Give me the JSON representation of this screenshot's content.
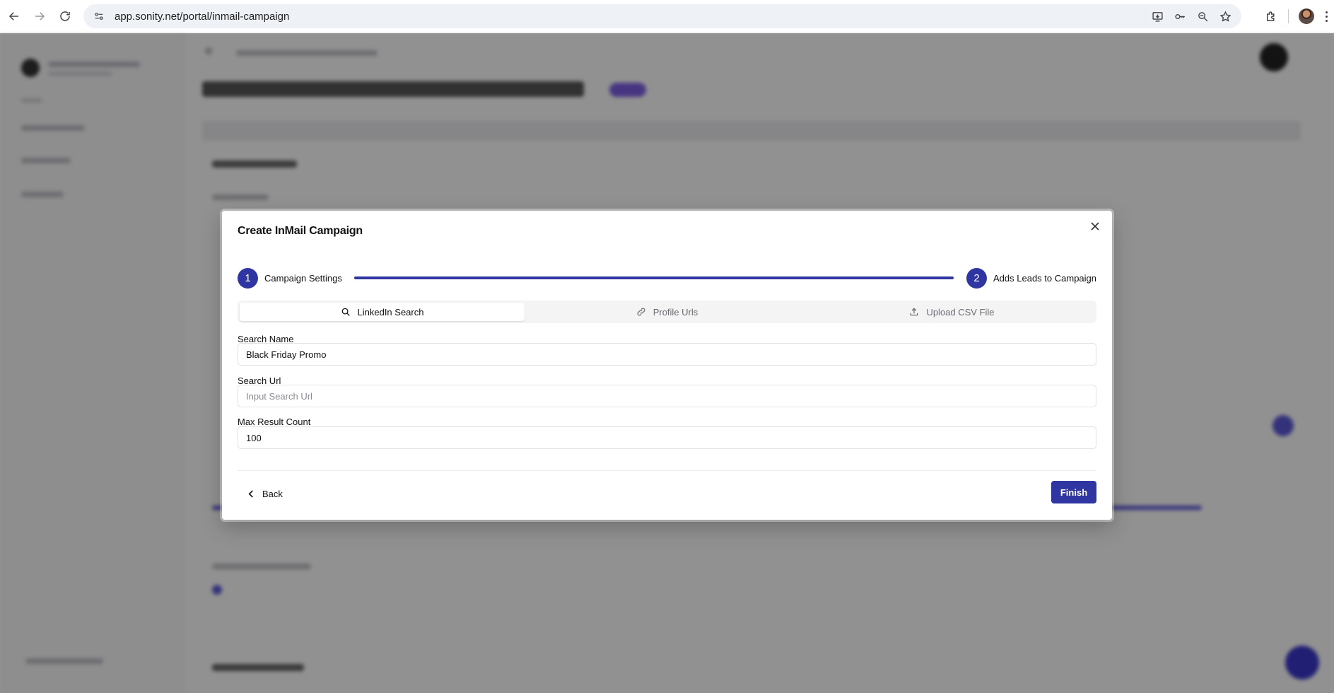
{
  "browser": {
    "url": "app.sonity.net/portal/inmail-campaign"
  },
  "modal": {
    "title": "Create InMail Campaign",
    "steps": [
      {
        "number": "1",
        "label": "Campaign Settings"
      },
      {
        "number": "2",
        "label": "Adds Leads to Campaign"
      }
    ],
    "tabs": [
      {
        "label": "LinkedIn Search",
        "icon": "search-icon",
        "active": true
      },
      {
        "label": "Profile Urls",
        "icon": "link-icon",
        "active": false
      },
      {
        "label": "Upload CSV File",
        "icon": "upload-icon",
        "active": false
      }
    ],
    "fields": {
      "search_name": {
        "label": "Search Name",
        "value": "Black Friday Promo",
        "placeholder": ""
      },
      "search_url": {
        "label": "Search Url",
        "value": "",
        "placeholder": "Input Search Url"
      },
      "max_result_count": {
        "label": "Max Result Count",
        "value": "100",
        "placeholder": ""
      }
    },
    "back_label": "Back",
    "finish_label": "Finish"
  },
  "colors": {
    "accent": "#2f36a2",
    "overlay": "rgba(0,0,0,0.42)"
  }
}
